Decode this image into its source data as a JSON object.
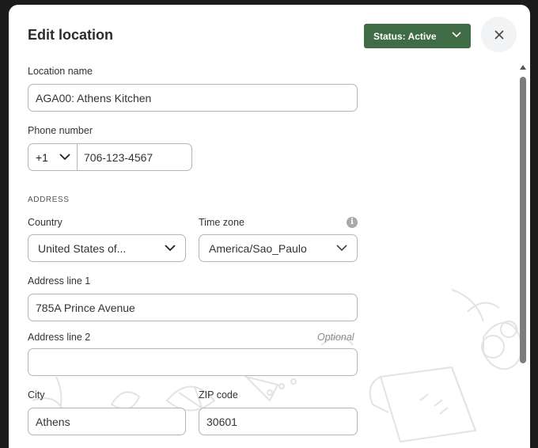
{
  "modal": {
    "title": "Edit location",
    "status_label": "Status: Active"
  },
  "form": {
    "location_name": {
      "label": "Location name",
      "value": "AGA00: Athens Kitchen"
    },
    "phone": {
      "label": "Phone number",
      "country_code": "+1",
      "value": "706-123-4567"
    },
    "address_section": "ADDRESS",
    "country": {
      "label": "Country",
      "value": "United States of..."
    },
    "time_zone": {
      "label": "Time zone",
      "value": "America/Sao_Paulo"
    },
    "address_line_1": {
      "label": "Address line 1",
      "value": "785A Prince Avenue"
    },
    "address_line_2": {
      "label": "Address line 2",
      "optional": "Optional",
      "value": ""
    },
    "city": {
      "label": "City",
      "value": "Athens"
    },
    "zip": {
      "label": "ZIP code",
      "value": "30601"
    }
  },
  "colors": {
    "status_bg": "#3f6c45",
    "border": "#b5b5b5",
    "close_bg": "#f1f3f5"
  }
}
